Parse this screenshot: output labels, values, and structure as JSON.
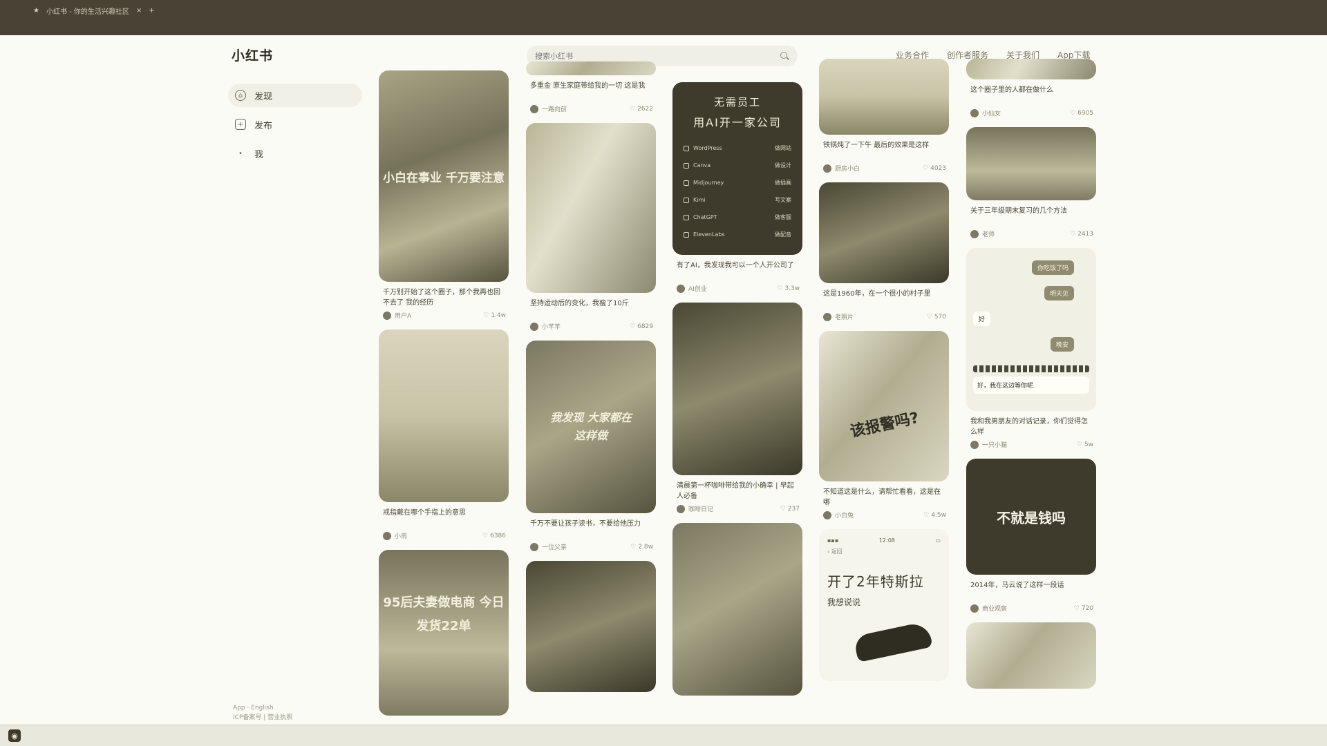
{
  "browser": {
    "tab_title": "小红书 - 你的生活兴趣社区",
    "new_tab": "+"
  },
  "header": {
    "logo": "小红书",
    "search_placeholder": "搜索小红书",
    "nav": [
      "业务合作",
      "创作者服务",
      "关于我们",
      "App下载"
    ]
  },
  "sidebar": {
    "items": [
      {
        "label": "发现",
        "icon": "home-icon"
      },
      {
        "label": "发布",
        "icon": "plus-icon"
      },
      {
        "label": "我",
        "icon": "user-icon"
      }
    ],
    "footer_line1": "App · English",
    "footer_line2": "ICP备案号 | 营业执照"
  },
  "cards": [
    {
      "id": "c1",
      "thumb_text": "小白在事业 千万要注意",
      "title": "千万别开始了这个圈子，那个我再也回不去了 我的经历",
      "author": "用户A",
      "likes": "1.4w"
    },
    {
      "id": "c2",
      "thumb_text": "",
      "title": "戒指戴在哪个手指上的意思",
      "author": "小雨",
      "likes": "6386"
    },
    {
      "id": "c3",
      "thumb_text": "95后夫妻做电商 今日发货22单",
      "title": "",
      "author": "",
      "likes": ""
    },
    {
      "id": "c4",
      "thumb_text": "",
      "title": "多重金 原生家庭带给我的一切 这是我",
      "author": "一路向前",
      "likes": "2622"
    },
    {
      "id": "c5",
      "thumb_text": "",
      "title": "坚持运动后的变化，我瘦了10斤",
      "author": "小芊芊",
      "likes": "6829"
    },
    {
      "id": "c6",
      "thumb_text": "我发现 大家都在这样做",
      "title": "千万不要让孩子读书，不要给他压力",
      "author": "一位父亲",
      "likes": "2.8w"
    },
    {
      "id": "c7",
      "thumb_text": "",
      "title": "",
      "author": "",
      "likes": ""
    },
    {
      "id": "c8",
      "ai_title1": "无需员工",
      "ai_title2": "用AI开一家公司",
      "tools": [
        [
          "WordPress",
          "做网站"
        ],
        [
          "Canva",
          "做设计"
        ],
        [
          "Midjourney",
          "做插画"
        ],
        [
          "Kimi",
          "写文案"
        ],
        [
          "ChatGPT",
          "做客服"
        ],
        [
          "ElevenLabs",
          "做配音"
        ]
      ],
      "title": "有了AI，我发现我可以一个人开公司了",
      "author": "AI创业",
      "likes": "3.3w"
    },
    {
      "id": "c9",
      "thumb_text": "",
      "title": "清晨第一杯咖啡带给我的小确幸 | 早起人必备",
      "author": "咖啡日记",
      "likes": "237"
    },
    {
      "id": "c10",
      "thumb_text": "",
      "title": "",
      "author": "",
      "likes": ""
    },
    {
      "id": "c11",
      "thumb_text": "",
      "title": "铁锅炖了一下午 最后的效果是这样",
      "author": "厨房小白",
      "likes": "4023"
    },
    {
      "id": "c12",
      "thumb_text": "",
      "title": "这是1960年，在一个很小的村子里",
      "author": "老照片",
      "likes": "570"
    },
    {
      "id": "c13",
      "thumb_text": "该报警吗?",
      "title": "不知道这是什么，请帮忙看看，这是在哪",
      "author": "小白兔",
      "likes": "4.5w"
    },
    {
      "id": "c14",
      "status_time": "12:08",
      "back": "返回",
      "tesla_title": "开了2年特斯拉",
      "tesla_sub": "我想说说",
      "title": "",
      "author": "",
      "likes": ""
    },
    {
      "id": "c15",
      "thumb_text": "",
      "title": "这个圈子里的人都在做什么",
      "author": "小仙女",
      "likes": "6905"
    },
    {
      "id": "c16",
      "thumb_text": "",
      "title": "关于三年级期末复习的几个方法",
      "author": "老师",
      "likes": "2413"
    },
    {
      "id": "c17",
      "bubbles": [
        "你吃饭了吗",
        "明天见",
        "晚安"
      ],
      "left_bubble": "好",
      "note": "好，我在这边等你呢",
      "title": "我和我男朋友的对话记录，你们觉得怎么样",
      "author": "一只小猫",
      "likes": "5w"
    },
    {
      "id": "c18",
      "thumb_text": "不就是钱吗",
      "title": "2014年，马云说了这样一段话",
      "author": "商业观察",
      "likes": "720"
    },
    {
      "id": "c19",
      "thumb_text": "",
      "title": "",
      "author": "",
      "likes": ""
    }
  ]
}
